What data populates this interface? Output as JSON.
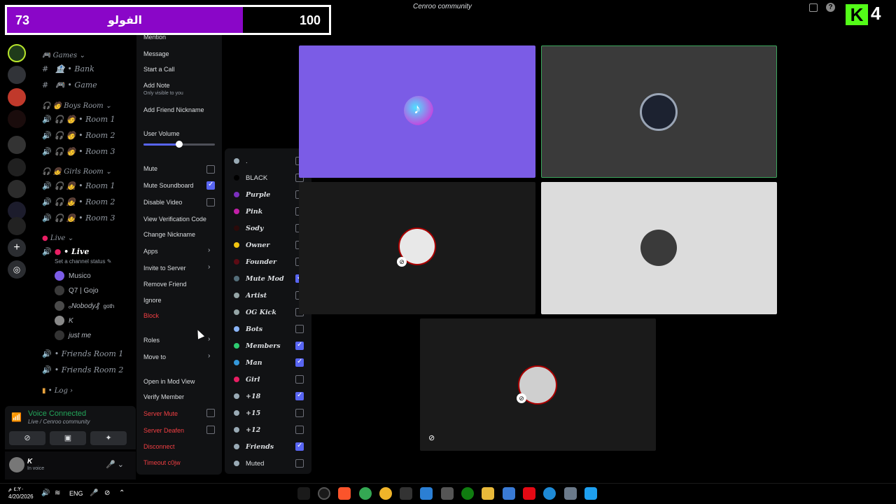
{
  "window": {
    "title": "Cenroo community"
  },
  "score": {
    "left": "73",
    "team": "الفولو",
    "right": "100"
  },
  "logo": {
    "letter": "K",
    "number": "4"
  },
  "channels": {
    "games_cat": "Games",
    "bank": "• Bank",
    "game": "• Game",
    "boys_cat": "Boys Room",
    "boys_rooms": [
      "• Room 1",
      "• Room 2",
      "• Room 3"
    ],
    "girls_cat": "Girls Room",
    "girls_rooms": [
      "• Room 1",
      "• Room 2",
      "• Room 3"
    ],
    "live_cat": "Live",
    "live_channel": "• Live",
    "live_status": "Set a channel status",
    "members": [
      "Musico",
      "Q7 | Gojo",
      "ₒNobody₰",
      "K",
      "just me"
    ],
    "member_tag": "goth",
    "friends_rooms": [
      "• Friends Room 1",
      "• Friends Room 2"
    ],
    "log_cat": "Log"
  },
  "voice": {
    "title": "Voice Connected",
    "subtitle": "Live / Cenroo community"
  },
  "user": {
    "name": "K",
    "status": "In voice"
  },
  "context_menu": {
    "mention": "Mention",
    "message": "Message",
    "start_call": "Start a Call",
    "add_note": "Add Note",
    "add_note_sub": "Only visible to you",
    "add_friend_nickname": "Add Friend Nickname",
    "user_volume": "User Volume",
    "user_volume_level": 0.5,
    "mute": "Mute",
    "mute_soundboard": "Mute Soundboard",
    "disable_video": "Disable Video",
    "view_verification": "View Verification Code",
    "change_nickname": "Change Nickname",
    "apps": "Apps",
    "invite": "Invite to Server",
    "remove_friend": "Remove Friend",
    "ignore": "Ignore",
    "block": "Block",
    "roles": "Roles",
    "move_to": "Move to",
    "open_mod_view": "Open in Mod View",
    "verify_member": "Verify Member",
    "server_mute": "Server Mute",
    "server_deafen": "Server Deafen",
    "disconnect": "Disconnect",
    "timeout": "Timeout c0jw"
  },
  "roles": [
    {
      "name": ".",
      "color": "#99aab5",
      "checked": false,
      "plain": true
    },
    {
      "name": "BLACK",
      "color": "#000000",
      "checked": false,
      "plain": true
    },
    {
      "name": "Purple",
      "color": "#7b2fbe",
      "checked": false,
      "plain": false
    },
    {
      "name": "Pink",
      "color": "#c21fa8",
      "checked": false,
      "plain": false
    },
    {
      "name": "Sody",
      "color": "#2b0a0a",
      "checked": false,
      "plain": false
    },
    {
      "name": "Owner",
      "color": "#f1c40f",
      "checked": false,
      "plain": false
    },
    {
      "name": "Founder",
      "color": "#5c0b14",
      "checked": false,
      "plain": false
    },
    {
      "name": "Mute Mod",
      "color": "#546e7a",
      "checked": true,
      "plain": false
    },
    {
      "name": "Artist",
      "color": "#95a5a6",
      "checked": false,
      "plain": false
    },
    {
      "name": "OG Kick",
      "color": "#95a5a6",
      "checked": false,
      "plain": false
    },
    {
      "name": "Bots",
      "color": "#8ab4f8",
      "checked": false,
      "plain": false
    },
    {
      "name": "Members",
      "color": "#2ecc71",
      "checked": true,
      "plain": false
    },
    {
      "name": "Man",
      "color": "#3498db",
      "checked": true,
      "plain": false
    },
    {
      "name": "Girl",
      "color": "#e91e63",
      "checked": false,
      "plain": false
    },
    {
      "name": "+18",
      "color": "#99aab5",
      "checked": true,
      "plain": false
    },
    {
      "name": "+15",
      "color": "#99aab5",
      "checked": false,
      "plain": false
    },
    {
      "name": "+12",
      "color": "#99aab5",
      "checked": false,
      "plain": false
    },
    {
      "name": "Friends",
      "color": "#99aab5",
      "checked": true,
      "plain": false
    },
    {
      "name": "Muted",
      "color": "#99aab5",
      "checked": false,
      "plain": true
    }
  ],
  "taskbar": {
    "time": "٤:٢٠ م",
    "date": "4/20/2026",
    "lang": "ENG"
  },
  "colors": {
    "accent": "#5865f2",
    "danger": "#f23f43",
    "online": "#23a55a",
    "score_bar": "#8a06c8"
  }
}
